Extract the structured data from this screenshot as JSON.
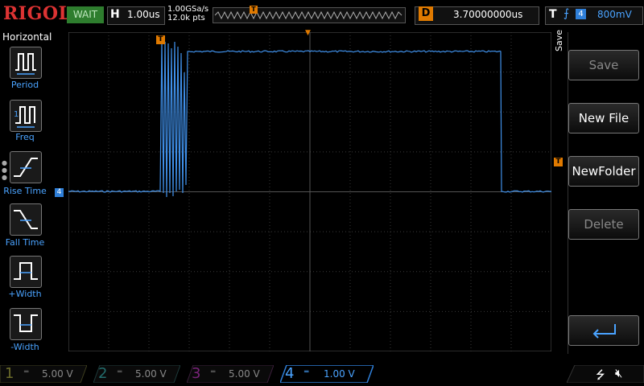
{
  "brand": "RIGOL",
  "run_status": "WAIT",
  "horizontal": {
    "label": "H",
    "timebase": "1.00us"
  },
  "acquisition": {
    "sample_rate": "1.00GSa/s",
    "memory_depth": "12.0k pts"
  },
  "delay": {
    "label": "D",
    "value": "3.70000000us"
  },
  "trigger": {
    "label": "T",
    "source": "4",
    "level": "800mV"
  },
  "left_menu": {
    "title": "Horizontal",
    "items": [
      {
        "label": "Period"
      },
      {
        "label": "Freq"
      },
      {
        "label": "Rise Time"
      },
      {
        "label": "Fall Time"
      },
      {
        "label": "+Width"
      },
      {
        "label": "-Width"
      }
    ]
  },
  "right_menu": {
    "title": "Save",
    "items": [
      {
        "label": "Save",
        "enabled": false
      },
      {
        "label": "New File",
        "enabled": true
      },
      {
        "label": "NewFolder",
        "enabled": true
      },
      {
        "label": "Delete",
        "enabled": false
      }
    ]
  },
  "channels": [
    {
      "num": "1",
      "scale": "5.00 V",
      "color": "#a8a838",
      "active": false
    },
    {
      "num": "2",
      "scale": "5.00 V",
      "color": "#2aa2a2",
      "active": false
    },
    {
      "num": "3",
      "scale": "5.00 V",
      "color": "#b030b0",
      "active": false
    },
    {
      "num": "4",
      "scale": "1.00 V",
      "color": "#2f7fd8",
      "active": true
    }
  ],
  "markers": {
    "trigger_position": "T",
    "channel4": "4",
    "trigger_level": "T"
  },
  "colors": {
    "accent": "#2f7fd8",
    "trace": "#3f8fe8",
    "grid": "#3a3a3a",
    "orange": "#e07a00"
  }
}
